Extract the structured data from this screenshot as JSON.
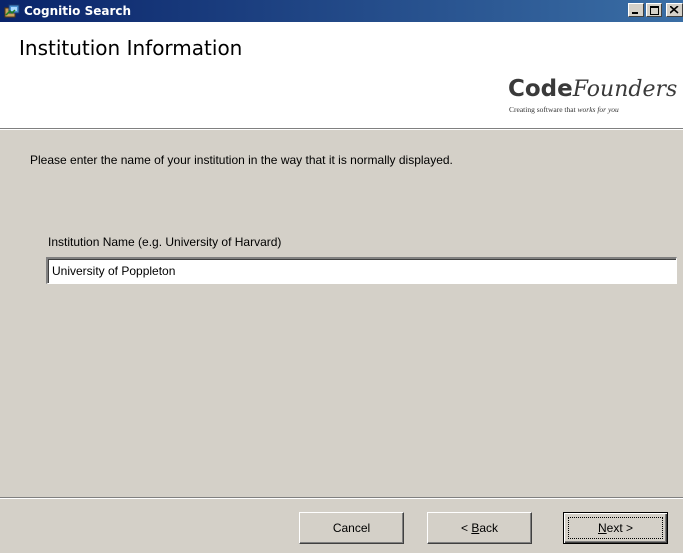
{
  "window": {
    "title": "Cognitio Search",
    "icon": "installer-icon"
  },
  "header": {
    "title": "Institution Information",
    "logo": {
      "word_bold": "Code",
      "word_italic": "Founders",
      "tagline_prefix": "Creating software that ",
      "tagline_italic": "works for you"
    }
  },
  "body": {
    "instruction": "Please enter the name of your institution in the way that it is normally displayed.",
    "institution_field": {
      "label": "Institution Name  (e.g. University of Harvard)",
      "value": "University of Poppleton"
    }
  },
  "buttons": {
    "cancel": "Cancel",
    "back_symbol": "< ",
    "back_mnemonic": "B",
    "back_rest": "ack",
    "next_mnemonic": "N",
    "next_rest": "ext >"
  },
  "colors": {
    "titlebar_start": "#0a246a",
    "titlebar_end": "#3a6ea5",
    "dialog_face": "#d4d0c8",
    "header_bg": "#ffffff"
  }
}
